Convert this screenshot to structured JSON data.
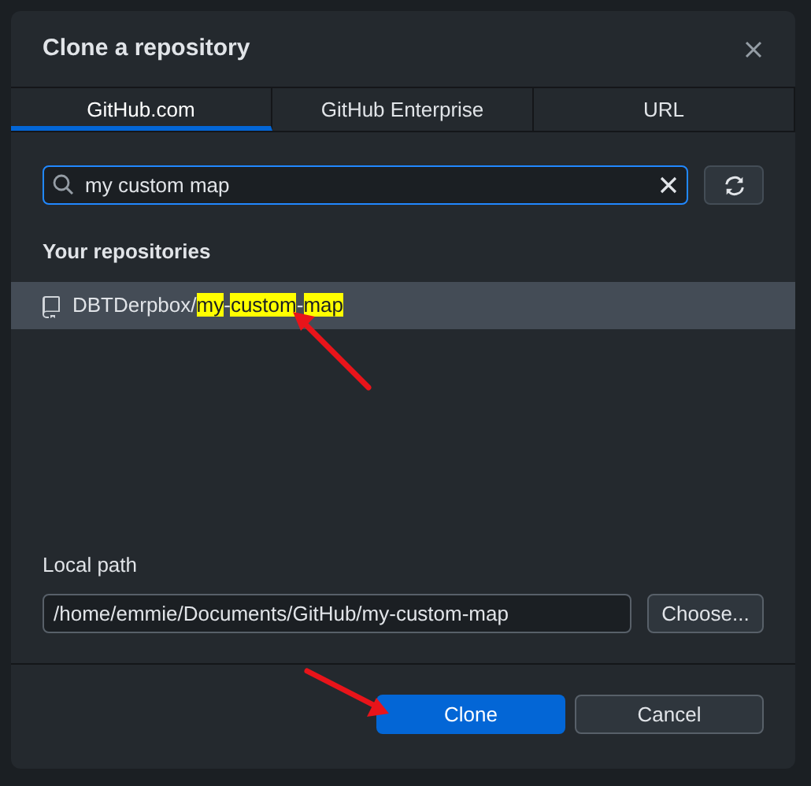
{
  "dialog": {
    "title": "Clone a repository"
  },
  "tabs": [
    {
      "label": "GitHub.com",
      "selected": true
    },
    {
      "label": "GitHub Enterprise",
      "selected": false
    },
    {
      "label": "URL",
      "selected": false
    }
  ],
  "search": {
    "value": "my custom map"
  },
  "repositories": {
    "heading": "Your repositories",
    "items": [
      {
        "selected": true,
        "name_parts": [
          {
            "text": "DBTDerpbox/",
            "highlighted": false
          },
          {
            "text": "my",
            "highlighted": true
          },
          {
            "text": "-",
            "highlighted": false
          },
          {
            "text": "custom",
            "highlighted": true
          },
          {
            "text": "-",
            "highlighted": false
          },
          {
            "text": "map",
            "highlighted": true
          }
        ]
      }
    ]
  },
  "local_path": {
    "label": "Local path",
    "value": "/home/emmie/Documents/GitHub/my-custom-map",
    "choose_button": "Choose..."
  },
  "buttons": [
    {
      "label": "Clone",
      "kind": "primary"
    },
    {
      "label": "Cancel",
      "kind": "secondary"
    }
  ]
}
